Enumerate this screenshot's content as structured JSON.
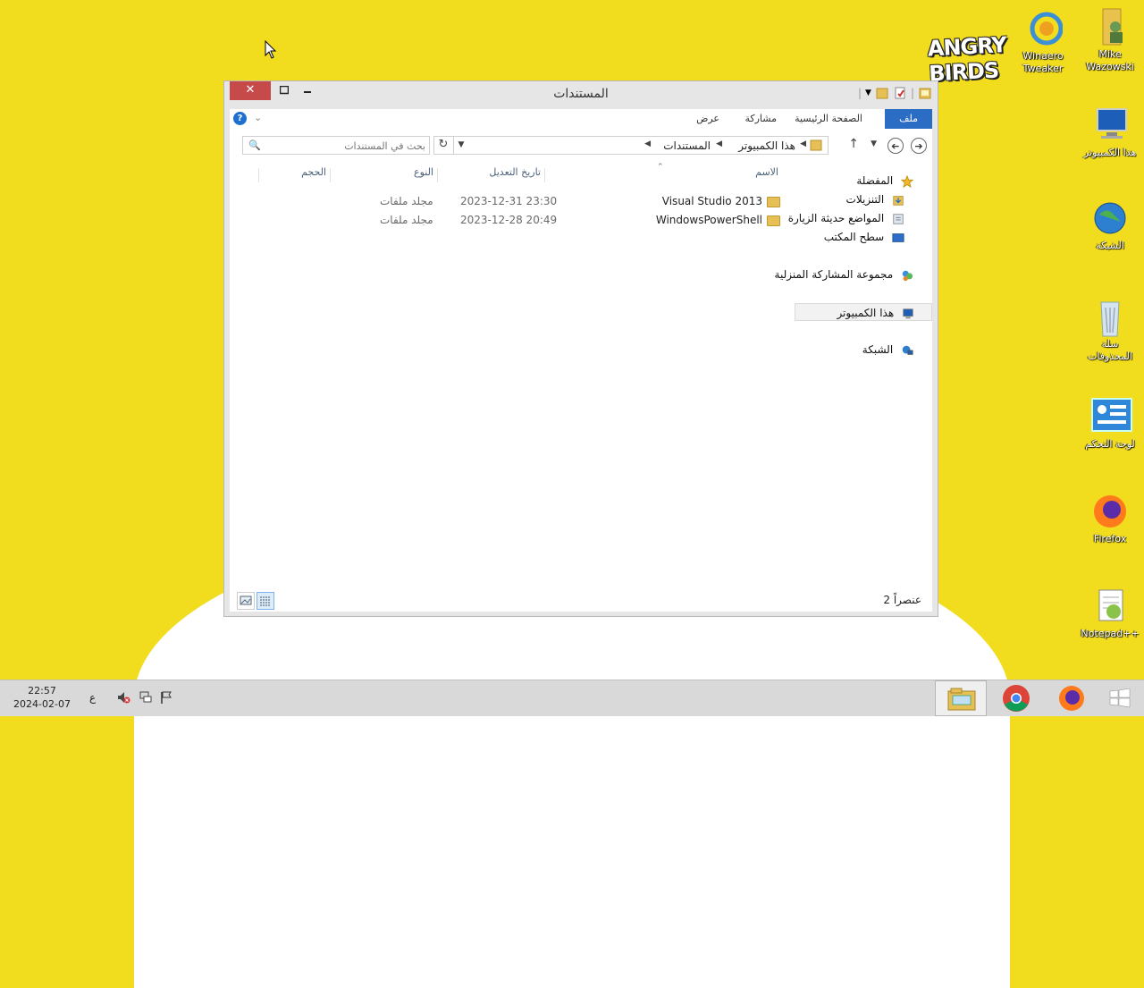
{
  "desktop": {
    "brand_logo_text": "ANGRY BIRDS",
    "icons": [
      {
        "label": "Winaero Tweaker",
        "icon": "winaero-tweaker-icon"
      },
      {
        "label": "Mike Wazowski",
        "icon": "user-folder-icon"
      },
      {
        "label": "هذا الكمبيوتر",
        "icon": "computer-icon"
      },
      {
        "label": "الشبكة",
        "icon": "network-globe-icon"
      },
      {
        "label": "سلة المحذوفات",
        "icon": "recycle-bin-icon"
      },
      {
        "label": "لوحة التحكم",
        "icon": "control-panel-icon"
      },
      {
        "label": "Firefox",
        "icon": "firefox-icon"
      },
      {
        "label": "Notepad++",
        "icon": "notepadpp-icon"
      }
    ]
  },
  "window": {
    "title": "المستندات",
    "ribbon_tabs": [
      "ملف",
      "الصفحة الرئيسية",
      "مشاركة",
      "عرض"
    ],
    "breadcrumb": [
      "هذا الكمبيوتر",
      "المستندات"
    ],
    "search_placeholder": "بحث في المستندات",
    "nav_pane": [
      {
        "label": "المفضلة",
        "icon": "star-icon"
      },
      {
        "label": "التنزيلات",
        "icon": "downloads-folder-icon"
      },
      {
        "label": "المواضع حديثة الزيارة",
        "icon": "recent-places-icon"
      },
      {
        "label": "سطح المكتب",
        "icon": "desktop-icon"
      },
      {
        "label": "مجموعة المشاركة المنزلية",
        "icon": "homegroup-icon"
      },
      {
        "label": "هذا الكمبيوتر",
        "icon": "computer-icon"
      },
      {
        "label": "الشبكة",
        "icon": "network-icon"
      }
    ],
    "columns": [
      "الاسم",
      "تاريخ التعديل",
      "النوع",
      "الحجم"
    ],
    "files": [
      {
        "name": "Visual Studio 2013",
        "modified": "2023-12-31 23:30",
        "type": "مجلد ملفات",
        "size": ""
      },
      {
        "name": "WindowsPowerShell",
        "modified": "2023-12-28 20:49",
        "type": "مجلد ملفات",
        "size": ""
      }
    ],
    "status_text": "2 عنصراً",
    "close_glyph": "✕"
  },
  "taskbar": {
    "time": "22:57",
    "date": "2024-02-07",
    "lang": "ع",
    "pinned": [
      "file-explorer",
      "chrome",
      "firefox"
    ]
  },
  "colors": {
    "desktop": "#f1dc1e",
    "accent": "#2b6cc4",
    "close": "#c74a4a"
  }
}
